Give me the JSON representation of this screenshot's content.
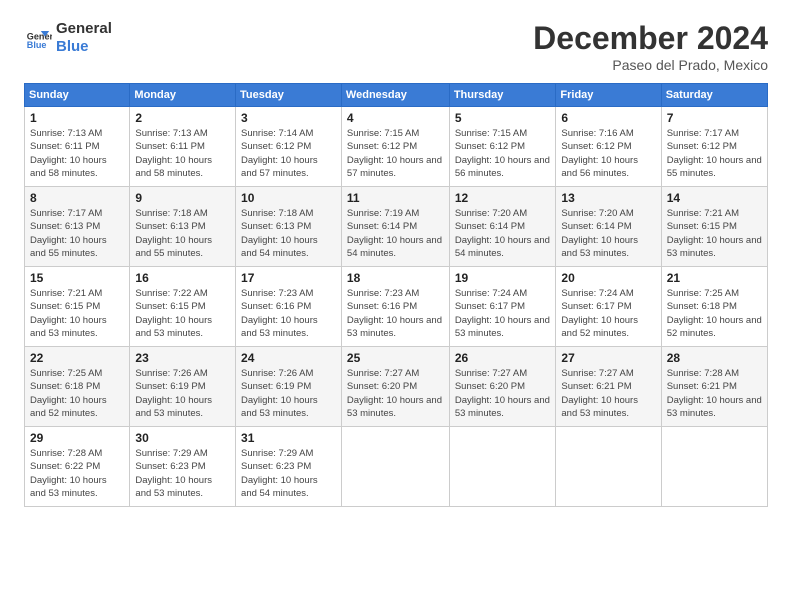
{
  "logo": {
    "line1": "General",
    "line2": "Blue"
  },
  "title": "December 2024",
  "location": "Paseo del Prado, Mexico",
  "days_of_week": [
    "Sunday",
    "Monday",
    "Tuesday",
    "Wednesday",
    "Thursday",
    "Friday",
    "Saturday"
  ],
  "weeks": [
    [
      {
        "day": "1",
        "sunrise": "7:13 AM",
        "sunset": "6:11 PM",
        "daylight": "10 hours and 58 minutes."
      },
      {
        "day": "2",
        "sunrise": "7:13 AM",
        "sunset": "6:11 PM",
        "daylight": "10 hours and 58 minutes."
      },
      {
        "day": "3",
        "sunrise": "7:14 AM",
        "sunset": "6:12 PM",
        "daylight": "10 hours and 57 minutes."
      },
      {
        "day": "4",
        "sunrise": "7:15 AM",
        "sunset": "6:12 PM",
        "daylight": "10 hours and 57 minutes."
      },
      {
        "day": "5",
        "sunrise": "7:15 AM",
        "sunset": "6:12 PM",
        "daylight": "10 hours and 56 minutes."
      },
      {
        "day": "6",
        "sunrise": "7:16 AM",
        "sunset": "6:12 PM",
        "daylight": "10 hours and 56 minutes."
      },
      {
        "day": "7",
        "sunrise": "7:17 AM",
        "sunset": "6:12 PM",
        "daylight": "10 hours and 55 minutes."
      }
    ],
    [
      {
        "day": "8",
        "sunrise": "7:17 AM",
        "sunset": "6:13 PM",
        "daylight": "10 hours and 55 minutes."
      },
      {
        "day": "9",
        "sunrise": "7:18 AM",
        "sunset": "6:13 PM",
        "daylight": "10 hours and 55 minutes."
      },
      {
        "day": "10",
        "sunrise": "7:18 AM",
        "sunset": "6:13 PM",
        "daylight": "10 hours and 54 minutes."
      },
      {
        "day": "11",
        "sunrise": "7:19 AM",
        "sunset": "6:14 PM",
        "daylight": "10 hours and 54 minutes."
      },
      {
        "day": "12",
        "sunrise": "7:20 AM",
        "sunset": "6:14 PM",
        "daylight": "10 hours and 54 minutes."
      },
      {
        "day": "13",
        "sunrise": "7:20 AM",
        "sunset": "6:14 PM",
        "daylight": "10 hours and 53 minutes."
      },
      {
        "day": "14",
        "sunrise": "7:21 AM",
        "sunset": "6:15 PM",
        "daylight": "10 hours and 53 minutes."
      }
    ],
    [
      {
        "day": "15",
        "sunrise": "7:21 AM",
        "sunset": "6:15 PM",
        "daylight": "10 hours and 53 minutes."
      },
      {
        "day": "16",
        "sunrise": "7:22 AM",
        "sunset": "6:15 PM",
        "daylight": "10 hours and 53 minutes."
      },
      {
        "day": "17",
        "sunrise": "7:23 AM",
        "sunset": "6:16 PM",
        "daylight": "10 hours and 53 minutes."
      },
      {
        "day": "18",
        "sunrise": "7:23 AM",
        "sunset": "6:16 PM",
        "daylight": "10 hours and 53 minutes."
      },
      {
        "day": "19",
        "sunrise": "7:24 AM",
        "sunset": "6:17 PM",
        "daylight": "10 hours and 53 minutes."
      },
      {
        "day": "20",
        "sunrise": "7:24 AM",
        "sunset": "6:17 PM",
        "daylight": "10 hours and 52 minutes."
      },
      {
        "day": "21",
        "sunrise": "7:25 AM",
        "sunset": "6:18 PM",
        "daylight": "10 hours and 52 minutes."
      }
    ],
    [
      {
        "day": "22",
        "sunrise": "7:25 AM",
        "sunset": "6:18 PM",
        "daylight": "10 hours and 52 minutes."
      },
      {
        "day": "23",
        "sunrise": "7:26 AM",
        "sunset": "6:19 PM",
        "daylight": "10 hours and 53 minutes."
      },
      {
        "day": "24",
        "sunrise": "7:26 AM",
        "sunset": "6:19 PM",
        "daylight": "10 hours and 53 minutes."
      },
      {
        "day": "25",
        "sunrise": "7:27 AM",
        "sunset": "6:20 PM",
        "daylight": "10 hours and 53 minutes."
      },
      {
        "day": "26",
        "sunrise": "7:27 AM",
        "sunset": "6:20 PM",
        "daylight": "10 hours and 53 minutes."
      },
      {
        "day": "27",
        "sunrise": "7:27 AM",
        "sunset": "6:21 PM",
        "daylight": "10 hours and 53 minutes."
      },
      {
        "day": "28",
        "sunrise": "7:28 AM",
        "sunset": "6:21 PM",
        "daylight": "10 hours and 53 minutes."
      }
    ],
    [
      {
        "day": "29",
        "sunrise": "7:28 AM",
        "sunset": "6:22 PM",
        "daylight": "10 hours and 53 minutes."
      },
      {
        "day": "30",
        "sunrise": "7:29 AM",
        "sunset": "6:23 PM",
        "daylight": "10 hours and 53 minutes."
      },
      {
        "day": "31",
        "sunrise": "7:29 AM",
        "sunset": "6:23 PM",
        "daylight": "10 hours and 54 minutes."
      },
      null,
      null,
      null,
      null
    ]
  ]
}
